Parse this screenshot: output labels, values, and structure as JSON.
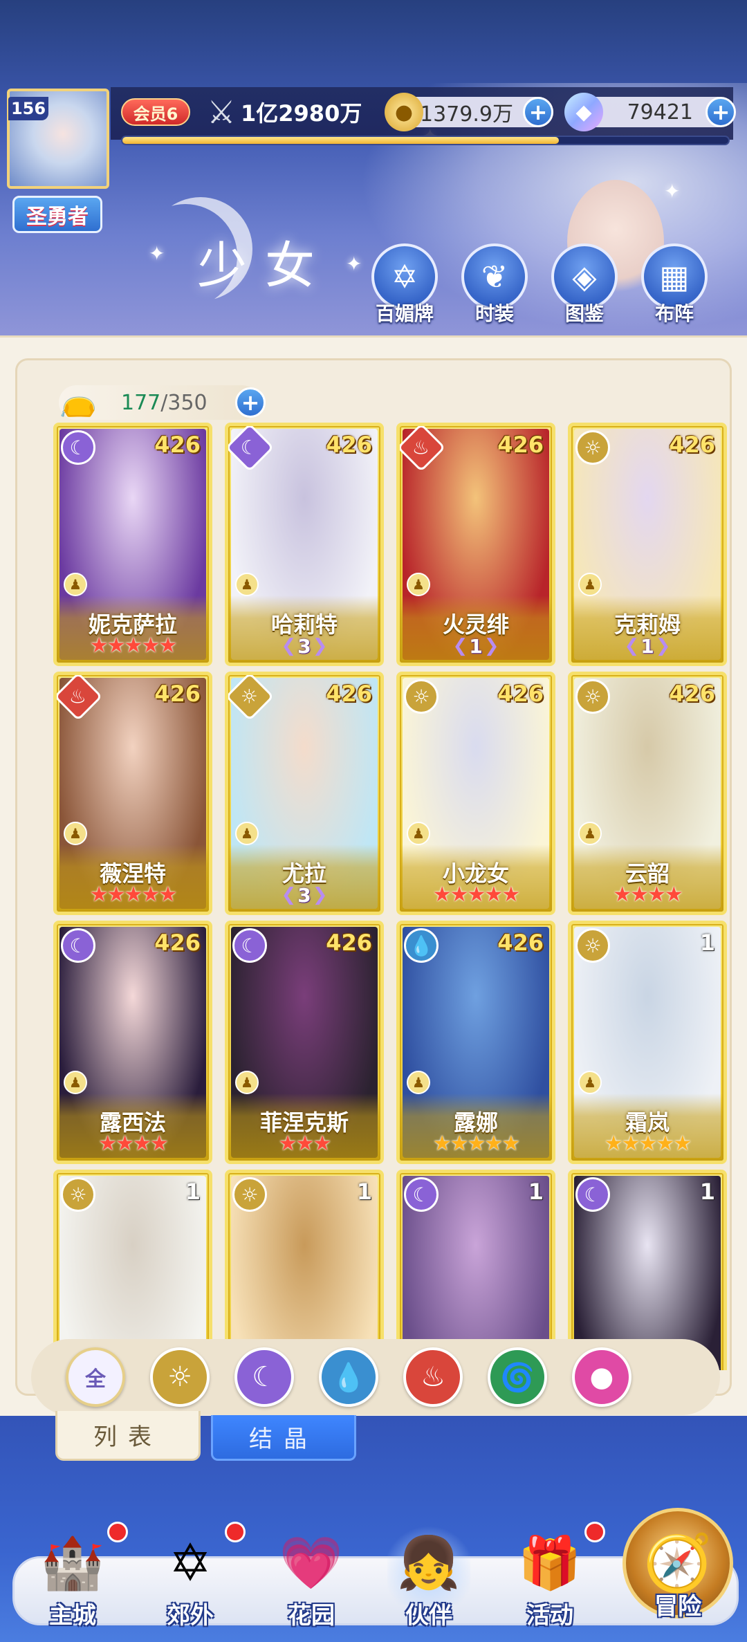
{
  "header": {
    "player_level": "156",
    "player_title": "圣勇者",
    "vip_label": "会员6",
    "power": "1亿2980万",
    "exp_progress_pct": 72,
    "gold": "1379.9万",
    "gems": "79421",
    "page_title": "少女",
    "feature_buttons": [
      {
        "label": "百媚牌",
        "icon": "card-badge-icon",
        "glyph": "✡"
      },
      {
        "label": "时装",
        "icon": "outfit-icon",
        "glyph": "❦"
      },
      {
        "label": "图鉴",
        "icon": "book-icon",
        "glyph": "◈"
      },
      {
        "label": "布阵",
        "icon": "grid-formation-icon",
        "glyph": "▦"
      }
    ]
  },
  "capacity": {
    "current": "177",
    "max": "/350"
  },
  "elements": {
    "moon": {
      "glyph": "☾",
      "color": "#8a62d6"
    },
    "sun": {
      "glyph": "☼",
      "color": "#c9a33a"
    },
    "fire": {
      "glyph": "♨",
      "color": "#d9463b"
    },
    "water": {
      "glyph": "💧",
      "color": "#3a8fd0"
    },
    "wind": {
      "glyph": "🌀",
      "color": "#2e9a55"
    },
    "dark": {
      "glyph": "●",
      "color": "#e04aa5"
    }
  },
  "cards": [
    {
      "name": "妮克萨拉",
      "level": "426",
      "element": "moon",
      "shape": "circle",
      "stars": 5,
      "star_color": "red",
      "wing": null,
      "bg": [
        "#6b3aa0",
        "#e9d7f5"
      ]
    },
    {
      "name": "哈莉特",
      "level": "426",
      "element": "moon",
      "shape": "diamond",
      "stars": 0,
      "star_color": "",
      "wing": "3",
      "bg": [
        "#f2f2f8",
        "#c8c2de"
      ]
    },
    {
      "name": "火灵绯",
      "level": "426",
      "element": "fire",
      "shape": "diamond",
      "stars": 0,
      "star_color": "",
      "wing": "1",
      "bg": [
        "#b8242a",
        "#f3c37a"
      ]
    },
    {
      "name": "克莉姆",
      "level": "426",
      "element": "sun",
      "shape": "circle",
      "stars": 0,
      "star_color": "",
      "wing": "1",
      "bg": [
        "#f6e7b8",
        "#e3d7f0"
      ]
    },
    {
      "name": "薇涅特",
      "level": "426",
      "element": "fire",
      "shape": "diamond",
      "stars": 5,
      "star_color": "red",
      "wing": null,
      "bg": [
        "#8a5538",
        "#f2d2c0"
      ]
    },
    {
      "name": "尤拉",
      "level": "426",
      "element": "sun",
      "shape": "diamond",
      "stars": 0,
      "star_color": "",
      "wing": "3",
      "bg": [
        "#bfe6f5",
        "#f4dccb"
      ]
    },
    {
      "name": "小龙女",
      "level": "426",
      "element": "sun",
      "shape": "circle",
      "stars": 5,
      "star_color": "red",
      "wing": null,
      "bg": [
        "#fbf5d6",
        "#d9dbef"
      ]
    },
    {
      "name": "云韶",
      "level": "426",
      "element": "sun",
      "shape": "circle",
      "stars": 4,
      "star_color": "red",
      "wing": null,
      "bg": [
        "#f1f0df",
        "#d6c9a8"
      ]
    },
    {
      "name": "露西法",
      "level": "426",
      "element": "moon",
      "shape": "circle",
      "stars": 4,
      "star_color": "red",
      "wing": null,
      "bg": [
        "#2a1d3c",
        "#f4d8d8"
      ]
    },
    {
      "name": "菲涅克斯",
      "level": "426",
      "element": "moon",
      "shape": "circle",
      "stars": 3,
      "star_color": "red",
      "wing": null,
      "bg": [
        "#2b2230",
        "#7a3e7a"
      ]
    },
    {
      "name": "露娜",
      "level": "426",
      "element": "water",
      "shape": "circle",
      "stars": 5,
      "star_color": "gold",
      "wing": null,
      "bg": [
        "#2f4fa0",
        "#6fa0e0"
      ]
    },
    {
      "name": "霜岚",
      "level": "1",
      "element": "sun",
      "shape": "circle",
      "stars": 5,
      "star_color": "gold",
      "wing": null,
      "bg": [
        "#eef1f6",
        "#c9d5e4"
      ]
    },
    {
      "name": "",
      "level": "1",
      "element": "sun",
      "shape": "circle",
      "stars": 0,
      "star_color": "",
      "wing": null,
      "bg": [
        "#f4f4f0",
        "#d8d0c4"
      ]
    },
    {
      "name": "",
      "level": "1",
      "element": "sun",
      "shape": "circle",
      "stars": 0,
      "star_color": "",
      "wing": null,
      "bg": [
        "#f7e1b8",
        "#c89a5a"
      ]
    },
    {
      "name": "",
      "level": "1",
      "element": "moon",
      "shape": "circle",
      "stars": 0,
      "star_color": "",
      "wing": null,
      "bg": [
        "#6a4e8a",
        "#c9a4d8"
      ]
    },
    {
      "name": "",
      "level": "1",
      "element": "moon",
      "shape": "circle",
      "stars": 0,
      "star_color": "",
      "wing": null,
      "bg": [
        "#2a2036",
        "#e8e4f2"
      ]
    }
  ],
  "filters": [
    {
      "key": "all",
      "label": "全",
      "icon": "all-filter-icon"
    },
    {
      "key": "sun",
      "label": "",
      "icon": "sun-element-icon"
    },
    {
      "key": "moon",
      "label": "",
      "icon": "moon-element-icon"
    },
    {
      "key": "water",
      "label": "",
      "icon": "water-element-icon"
    },
    {
      "key": "fire",
      "label": "",
      "icon": "fire-element-icon"
    },
    {
      "key": "wind",
      "label": "",
      "icon": "wind-element-icon"
    },
    {
      "key": "dark",
      "label": "",
      "icon": "dark-element-icon"
    }
  ],
  "tabs": {
    "list": "列表",
    "crystal": "结晶"
  },
  "nav": [
    {
      "label": "主城",
      "icon": "castle-icon",
      "glyph": "🏰",
      "dot": true
    },
    {
      "label": "郊外",
      "icon": "portal-icon",
      "glyph": "✡",
      "dot": true
    },
    {
      "label": "花园",
      "icon": "heart-garden-icon",
      "glyph": "💗",
      "dot": false
    },
    {
      "label": "伙伴",
      "icon": "partner-avatar-icon",
      "glyph": "👧",
      "dot": false,
      "active": true
    },
    {
      "label": "活动",
      "icon": "gift-box-icon",
      "glyph": "🎁",
      "dot": true
    },
    {
      "label": "冒险",
      "icon": "compass-icon",
      "glyph": "🧭",
      "dot": false
    }
  ]
}
